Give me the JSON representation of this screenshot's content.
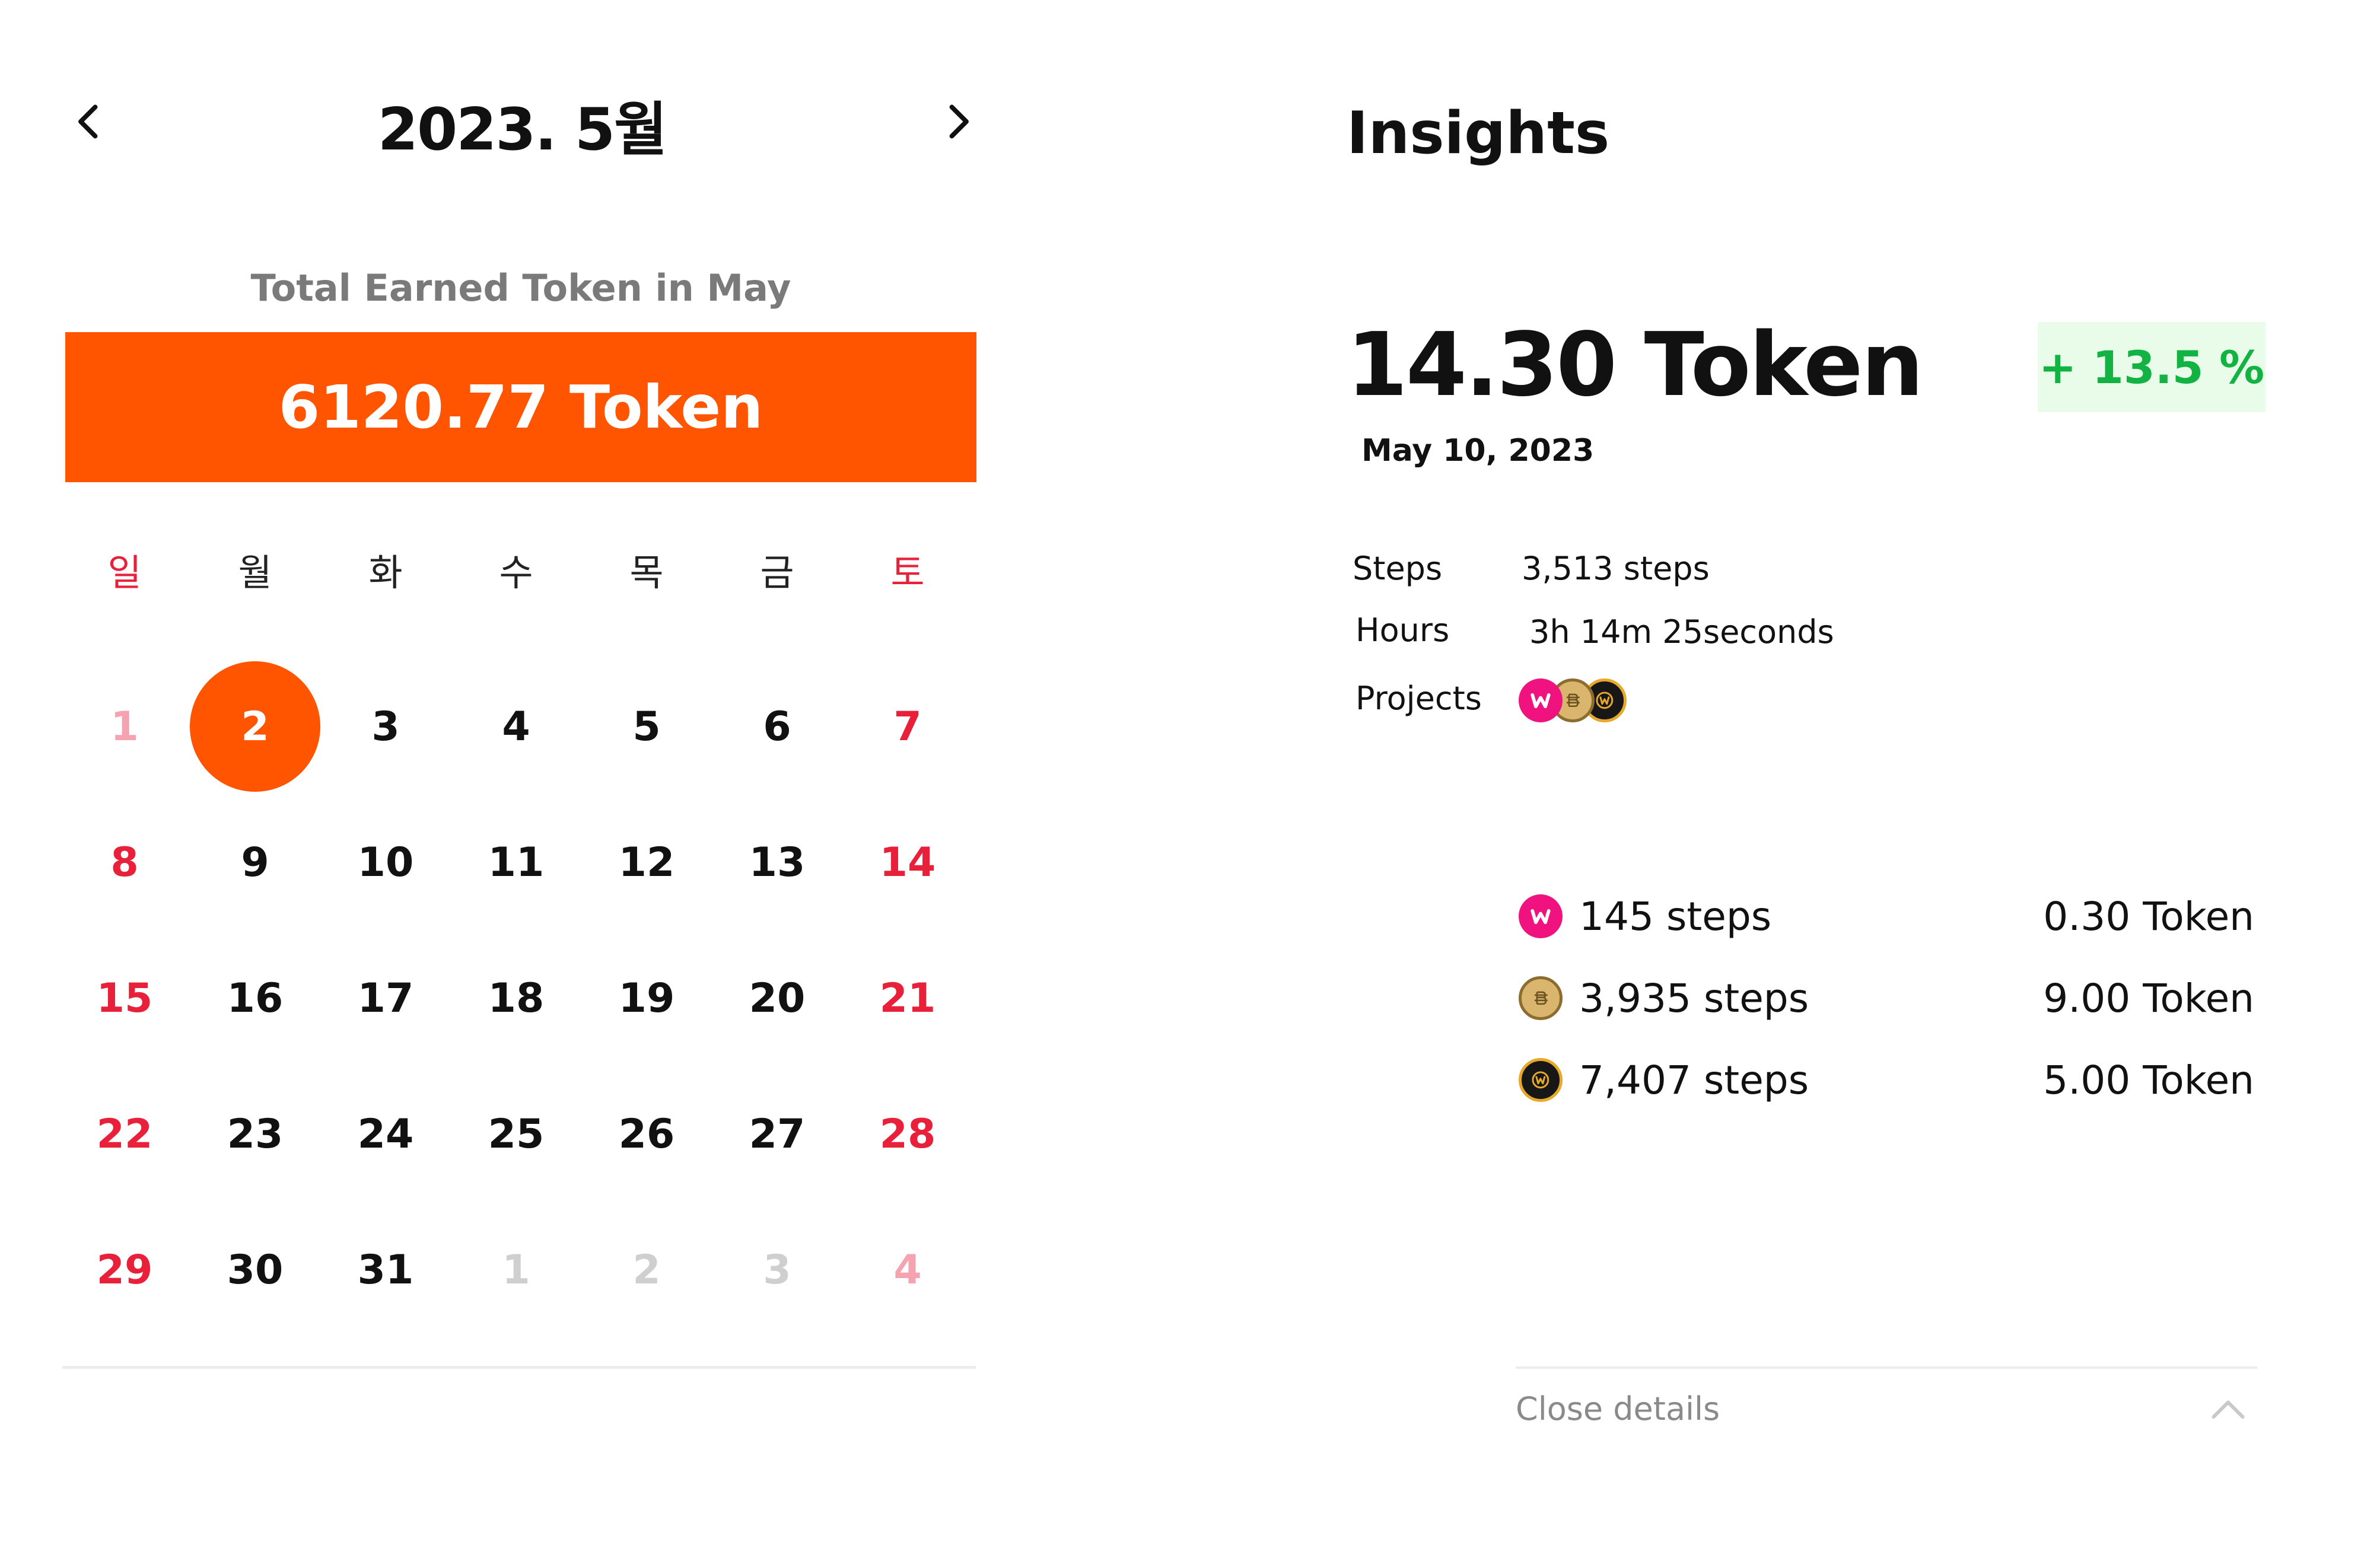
{
  "calendar": {
    "month_title": "2023. 5월",
    "earned_label": "Total Earned Token in May",
    "earned_value": "6120.77 Token",
    "weekdays": [
      "일",
      "월",
      "화",
      "수",
      "목",
      "금",
      "토"
    ],
    "days": [
      "1",
      "2",
      "3",
      "4",
      "5",
      "6",
      "7",
      "8",
      "9",
      "10",
      "11",
      "12",
      "13",
      "14",
      "15",
      "16",
      "17",
      "18",
      "19",
      "20",
      "21",
      "22",
      "23",
      "24",
      "25",
      "26",
      "27",
      "28",
      "29",
      "30",
      "31",
      "1",
      "2",
      "3",
      "4"
    ],
    "selected_day": "2",
    "prev_icon": "chevron-left-icon",
    "next_icon": "chevron-right-icon"
  },
  "insights": {
    "title": "Insights",
    "token_value": "14.30 Token",
    "change": "+ 13.5 %",
    "date": "May 10, 2023",
    "steps_label": "Steps",
    "steps_value": "3,513 steps",
    "hours_label": "Hours",
    "hours_value": "3h 14m 25seconds",
    "projects_label": "Projects",
    "projects": [
      {
        "icon": "w-coin-icon",
        "steps": "145 steps",
        "tokens": "0.30 Token"
      },
      {
        "icon": "b-coin-icon",
        "steps": "3,935 steps",
        "tokens": "9.00 Token"
      },
      {
        "icon": "k-coin-icon",
        "steps": "7,407 steps",
        "tokens": "5.00 Token"
      }
    ],
    "close_details": "Close details",
    "close_icon": "chevron-up-icon"
  },
  "colors": {
    "accent": "#ff5500",
    "weekend": "#e8203a",
    "positive": "#12b342",
    "positive_bg": "#e9fbe9",
    "coin_pink": "#f0127e",
    "coin_gold": "#d9b56e",
    "coin_dark": "#171717"
  }
}
